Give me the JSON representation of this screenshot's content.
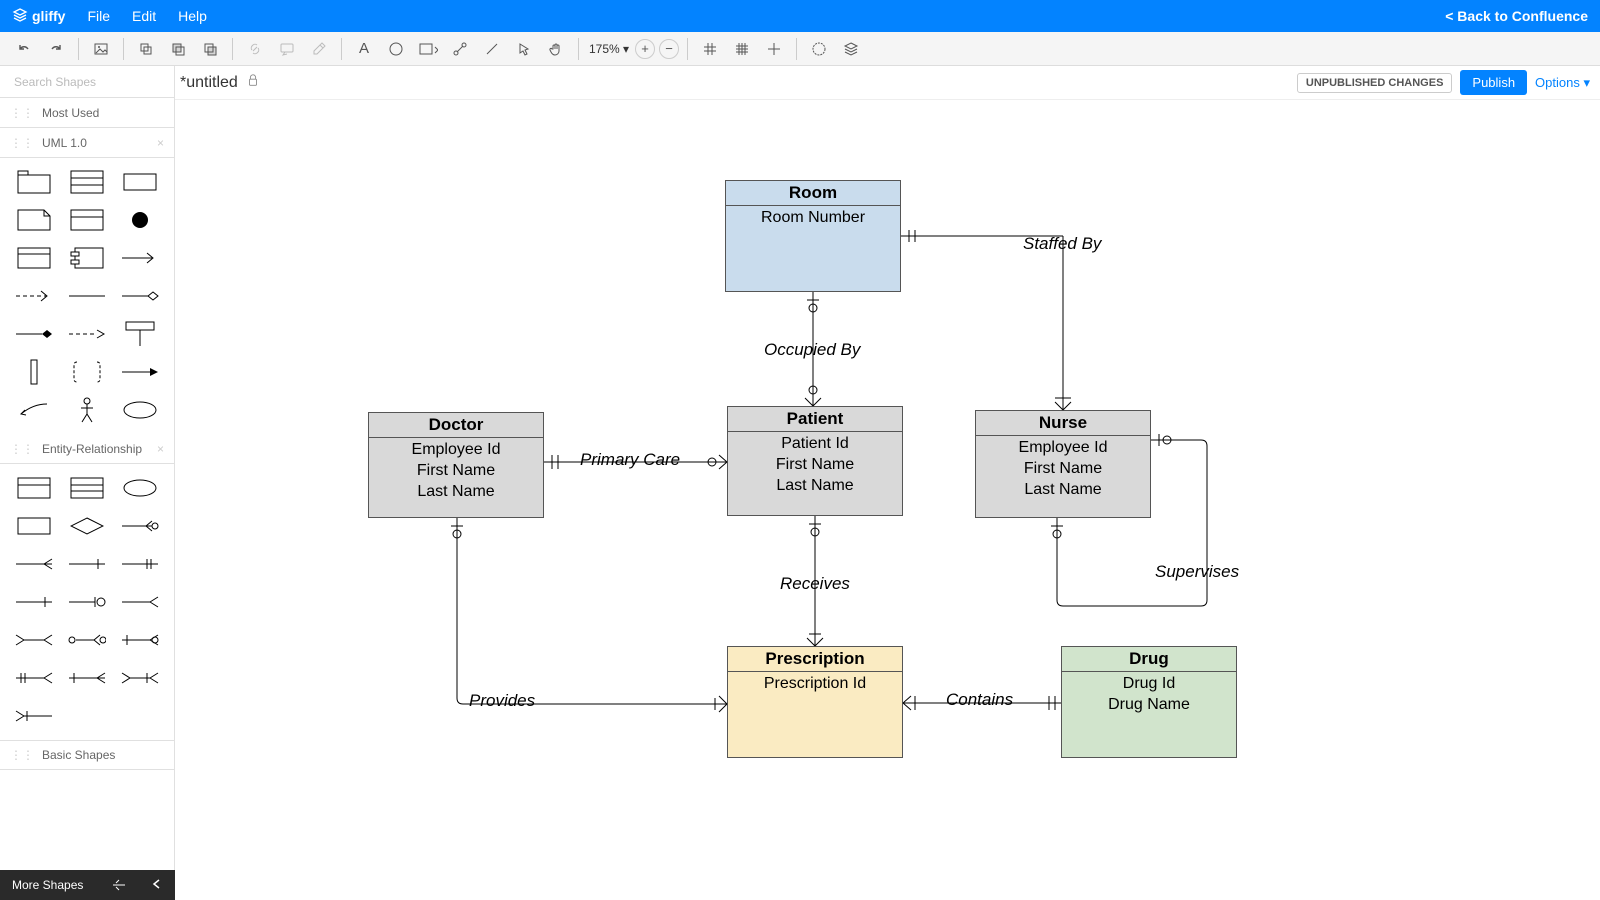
{
  "header": {
    "brand": "gliffy",
    "menu": [
      "File",
      "Edit",
      "Help"
    ],
    "back": "< Back to Confluence"
  },
  "toolbar": {
    "zoom": "175%"
  },
  "docbar": {
    "title": "*untitled",
    "badge": "UNPUBLISHED CHANGES",
    "publish": "Publish",
    "options": "Options"
  },
  "sidebar": {
    "search_placeholder": "Search Shapes",
    "sections": {
      "most_used": "Most Used",
      "uml": "UML 1.0",
      "er": "Entity-Relationship",
      "basic": "Basic Shapes"
    },
    "more": "More Shapes"
  },
  "diagram": {
    "room": {
      "title": "Room",
      "attrs": [
        "Room Number"
      ]
    },
    "doctor": {
      "title": "Doctor",
      "attrs": [
        "Employee Id",
        "First Name",
        "Last Name"
      ]
    },
    "patient": {
      "title": "Patient",
      "attrs": [
        "Patient Id",
        "First Name",
        "Last Name"
      ]
    },
    "nurse": {
      "title": "Nurse",
      "attrs": [
        "Employee Id",
        "First Name",
        "Last Name"
      ]
    },
    "prescription": {
      "title": "Prescription",
      "attrs": [
        "Prescription Id"
      ]
    },
    "drug": {
      "title": "Drug",
      "attrs": [
        "Drug Id",
        "Drug Name"
      ]
    },
    "rel": {
      "staffed_by": "Staffed By",
      "occupied_by": "Occupied By",
      "primary_care": "Primary Care",
      "receives": "Receives",
      "provides": "Provides",
      "contains": "Contains",
      "supervises": "Supervises"
    }
  }
}
